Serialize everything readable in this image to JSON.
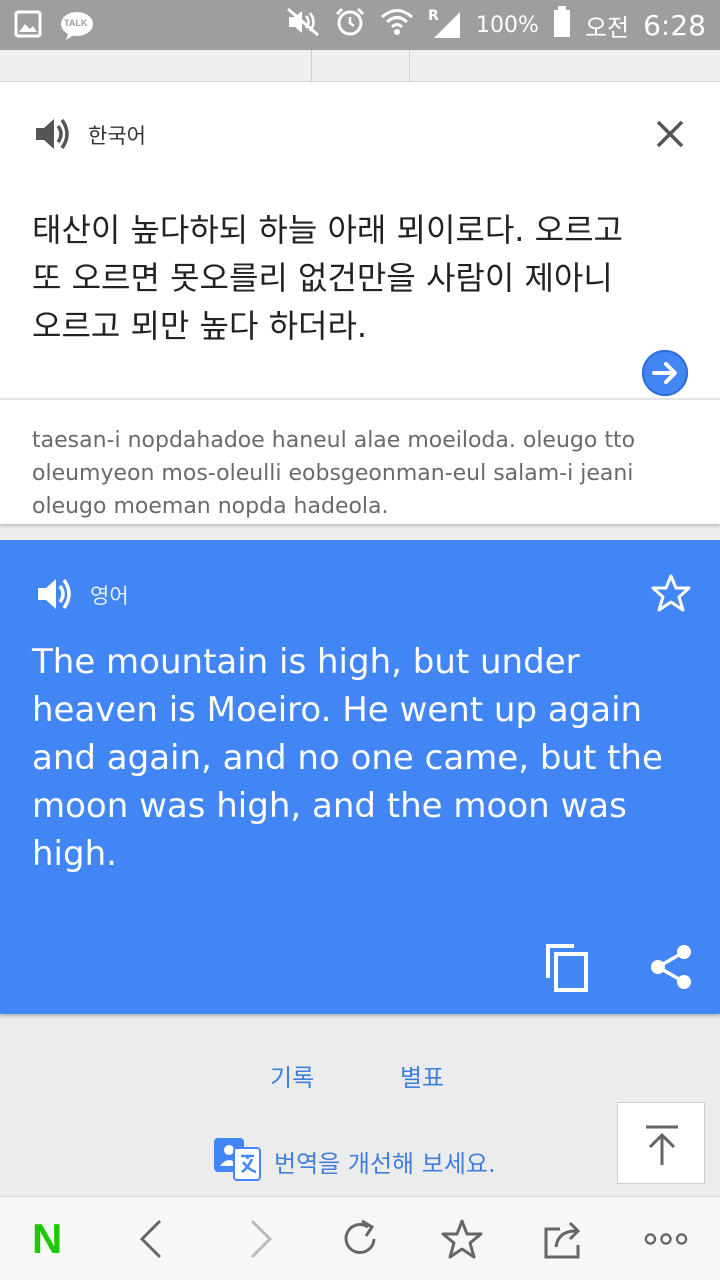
{
  "status_bar": {
    "battery_percent": "100%",
    "time_period": "오전",
    "time": "6:28",
    "talk_badge": "TALK",
    "signal_badge": "R",
    "icons": [
      "gallery-icon",
      "kakaotalk-icon",
      "mute-icon",
      "alarm-icon",
      "wifi-icon",
      "signal-icon",
      "battery-icon"
    ]
  },
  "source": {
    "language": "한국어",
    "text": "태산이 높다하되 하늘 아래 뫼이로다. 오르고 또 오르면 못오를리 없건만을 사람이 제아니 오르고 뫼만 높다 하더라.",
    "romanization": "taesan-i nopdahadoe haneul alae moeiloda. oleugo tto oleumyeon mos-oleulli eobsgeonman-eul salam-i jeani oleugo moeman nopda hadeola."
  },
  "target": {
    "language": "영어",
    "text": "The mountain is high, but under heaven is Moeiro. He went up again and again, and no one came, but the moon was high, and the moon was high."
  },
  "links": {
    "history": "기록",
    "phrasebook": "별표",
    "improve": "번역을 개선해 보세요."
  },
  "browser_bar": {
    "brand": "N"
  },
  "colors": {
    "accent": "#4285f4",
    "link": "#3f7fde",
    "naver_green": "#1ec800",
    "status_bar": "#9e9e9e"
  }
}
